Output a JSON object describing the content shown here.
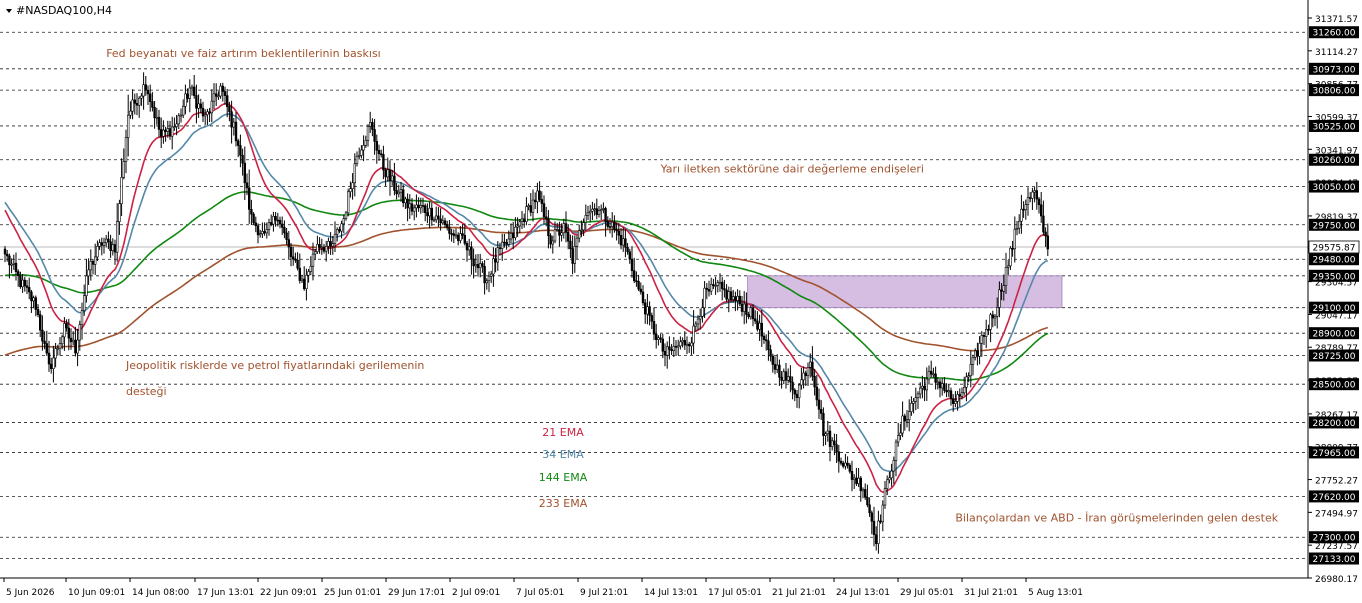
{
  "window": {
    "symbol_title": "#NASDAQ100,H4"
  },
  "colors": {
    "ema21": "#cc2244",
    "ema34": "#5588aa",
    "ema144": "#118811",
    "ema233": "#a0522d",
    "annotation": "#a0522d",
    "zone_fill": "#c8a8d8",
    "candle": "#000000",
    "grid": "#000000"
  },
  "chart_data": {
    "type": "candlestick",
    "instrument": "#NASDAQ100",
    "timeframe": "H4",
    "ylim": [
      26980,
      31430
    ],
    "y_tick_labels": [
      "31371.57",
      "31114.27",
      "30856.77",
      "30599.37",
      "30341.97",
      "30084.47",
      "29819.37",
      "29562.07",
      "29304.57",
      "29047.17",
      "28789.77",
      "28532.37",
      "28267.17",
      "28009.77",
      "27752.27",
      "27494.97",
      "27237.57",
      "26980.17"
    ],
    "y_tick_values": [
      31371.57,
      31114.27,
      30856.77,
      30599.37,
      30341.97,
      30084.47,
      29819.37,
      29562.07,
      29304.57,
      29047.17,
      28789.77,
      28532.37,
      28267.17,
      28009.77,
      27752.27,
      27494.97,
      27237.57,
      26980.17
    ],
    "level_lines": [
      31260.0,
      30973.0,
      30806.0,
      30525.0,
      30260.0,
      30050.0,
      29750.0,
      29480.0,
      29350.0,
      29100.0,
      28900.0,
      28725.0,
      28500.0,
      28200.0,
      27965.0,
      27620.0,
      27300.0,
      27133.0
    ],
    "level_labels": [
      "31260.00",
      "30973.00",
      "30806.00",
      "30525.00",
      "30260.00",
      "30050.00",
      "29750.00",
      "29480.00",
      "29350.00",
      "29100.00",
      "28900.00",
      "28725.00",
      "28500.00",
      "28200.00",
      "27965.00",
      "27620.00",
      "27300.00",
      "27133.00"
    ],
    "current_price": 29575.87,
    "current_price_label": "29575.87",
    "x_tick_labels": [
      "5 Jun 2026",
      "10 Jun 09:01",
      "14 Jun 08:00",
      "17 Jun 13:01",
      "22 Jun 09:01",
      "25 Jun 01:01",
      "29 Jun 17:01",
      "2 Jul 09:01",
      "7 Jul 05:01",
      "9 Jul 21:01",
      "14 Jul 13:01",
      "17 Jul 05:01",
      "21 Jul 21:01",
      "24 Jul 13:01",
      "29 Jul 05:01",
      "31 Jul 21:01",
      "5 Aug 13:01"
    ],
    "close_anchors": [
      [
        0,
        29520
      ],
      [
        7,
        29300
      ],
      [
        14,
        29120
      ],
      [
        20,
        28620
      ],
      [
        27,
        28930
      ],
      [
        32,
        28780
      ],
      [
        38,
        29400
      ],
      [
        44,
        29610
      ],
      [
        50,
        29580
      ],
      [
        56,
        30620
      ],
      [
        64,
        30860
      ],
      [
        71,
        30440
      ],
      [
        78,
        30540
      ],
      [
        84,
        30820
      ],
      [
        91,
        30580
      ],
      [
        98,
        30830
      ],
      [
        106,
        30400
      ],
      [
        112,
        29800
      ],
      [
        118,
        29650
      ],
      [
        124,
        29840
      ],
      [
        130,
        29500
      ],
      [
        136,
        29280
      ],
      [
        142,
        29610
      ],
      [
        148,
        29560
      ],
      [
        154,
        29800
      ],
      [
        160,
        30300
      ],
      [
        166,
        30530
      ],
      [
        172,
        30200
      ],
      [
        178,
        30020
      ],
      [
        184,
        29880
      ],
      [
        190,
        29880
      ],
      [
        196,
        29820
      ],
      [
        202,
        29700
      ],
      [
        208,
        29620
      ],
      [
        214,
        29450
      ],
      [
        219,
        29320
      ],
      [
        224,
        29520
      ],
      [
        230,
        29640
      ],
      [
        236,
        29820
      ],
      [
        242,
        29980
      ],
      [
        248,
        29640
      ],
      [
        254,
        29720
      ],
      [
        258,
        29480
      ],
      [
        264,
        29870
      ],
      [
        270,
        29880
      ],
      [
        276,
        29740
      ],
      [
        282,
        29580
      ],
      [
        288,
        29240
      ],
      [
        294,
        28960
      ],
      [
        300,
        28730
      ],
      [
        306,
        28800
      ],
      [
        312,
        28860
      ],
      [
        318,
        29200
      ],
      [
        324,
        29260
      ],
      [
        330,
        29180
      ],
      [
        336,
        29110
      ],
      [
        342,
        28980
      ],
      [
        348,
        28690
      ],
      [
        354,
        28560
      ],
      [
        360,
        28440
      ],
      [
        366,
        28700
      ],
      [
        372,
        28140
      ],
      [
        378,
        27980
      ],
      [
        384,
        27800
      ],
      [
        390,
        27700
      ],
      [
        396,
        27300
      ],
      [
        402,
        27800
      ],
      [
        408,
        28200
      ],
      [
        414,
        28400
      ],
      [
        420,
        28560
      ],
      [
        426,
        28500
      ],
      [
        432,
        28330
      ],
      [
        438,
        28560
      ],
      [
        444,
        28860
      ],
      [
        450,
        29080
      ],
      [
        456,
        29450
      ],
      [
        462,
        29880
      ],
      [
        468,
        30000
      ],
      [
        471,
        29790
      ],
      [
        474,
        29560
      ]
    ],
    "series": [
      {
        "name": "21 EMA",
        "period": 21
      },
      {
        "name": "34 EMA",
        "period": 34
      },
      {
        "name": "144 EMA",
        "period": 144
      },
      {
        "name": "233 EMA",
        "period": 233
      }
    ],
    "zone": {
      "from_bar": 338,
      "to_bar": "end",
      "price_high": 29350,
      "price_low": 29100
    },
    "annotations": [
      {
        "text": "Fed beyanatı ve faiz artırım beklentilerinin baskısı",
        "bar": 46,
        "price": 31065
      },
      {
        "text": "Jeopolitik risklerde ve petrol fiyatlarındaki gerilemenin",
        "bar": 55,
        "price": 28620
      },
      {
        "text": "desteği",
        "bar": 55,
        "price": 28415
      },
      {
        "text": "Yarı iletken sektörüne dair değerleme endişeleri",
        "bar": 298,
        "price": 30160
      },
      {
        "text": "Bilançolardan ve ABD - İran görüşmelerinden gelen destek",
        "bar": 432,
        "price": 27425
      }
    ],
    "legend": [
      {
        "label": "21 EMA",
        "color_key": "ema21",
        "price": 28095
      },
      {
        "label": "34 EMA",
        "color_key": "ema34",
        "price": 27920
      },
      {
        "label": "144 EMA",
        "color_key": "ema144",
        "price": 27740
      },
      {
        "label": "233 EMA",
        "color_key": "ema233",
        "price": 27535
      }
    ]
  }
}
